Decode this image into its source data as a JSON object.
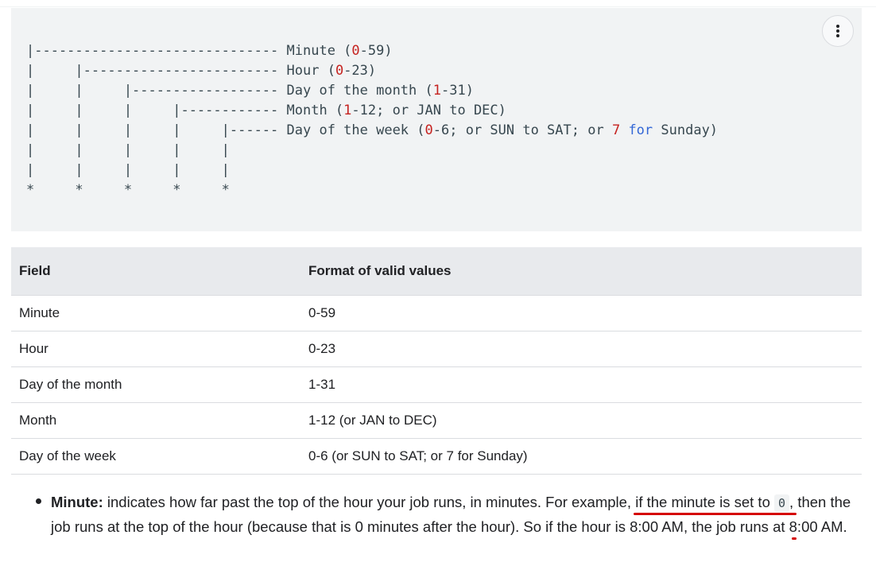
{
  "code": {
    "lines": [
      [
        "|------------------------------ Minute (",
        {
          "n": "0"
        },
        "-59)"
      ],
      [
        "|     |------------------------ Hour (",
        {
          "n": "0"
        },
        "-23)"
      ],
      [
        "|     |     |------------------ Day of the month (",
        {
          "n": "1"
        },
        "-31)"
      ],
      [
        "|     |     |     |------------ Month (",
        {
          "n": "1"
        },
        "-12; or JAN to DEC)"
      ],
      [
        "|     |     |     |     |------ Day of the week (",
        {
          "n": "0"
        },
        "-6; or SUN to SAT; or ",
        {
          "n": "7"
        },
        " ",
        {
          "k": "for"
        },
        " Sunday)"
      ],
      [
        "|     |     |     |     |"
      ],
      [
        "|     |     |     |     |"
      ],
      [
        "*     *     *     *     *"
      ]
    ]
  },
  "table": {
    "headers": [
      "Field",
      "Format of valid values"
    ],
    "rows": [
      [
        "Minute",
        "0-59"
      ],
      [
        "Hour",
        "0-23"
      ],
      [
        "Day of the month",
        "1-31"
      ],
      [
        "Month",
        "1-12 (or JAN to DEC)"
      ],
      [
        "Day of the week",
        "0-6 (or SUN to SAT; or 7 for Sunday)"
      ]
    ]
  },
  "desc": {
    "term": "Minute:",
    "text1": " indicates how far past the top of the hour your job runs, in minutes. For example, ",
    "highlight1": "if the minute is set to ",
    "code": "0",
    "highlight1_end": ",",
    "highlight2": " then the job runs at the top of the hour ",
    "text2": "(because that is 0 minutes after the hour). So if the hour is 8:00 AM, the job runs at 8:00 AM."
  },
  "colors": {
    "accent_red": "#d50000",
    "code_number": "#c5221f",
    "code_keyword": "#3367d6"
  }
}
